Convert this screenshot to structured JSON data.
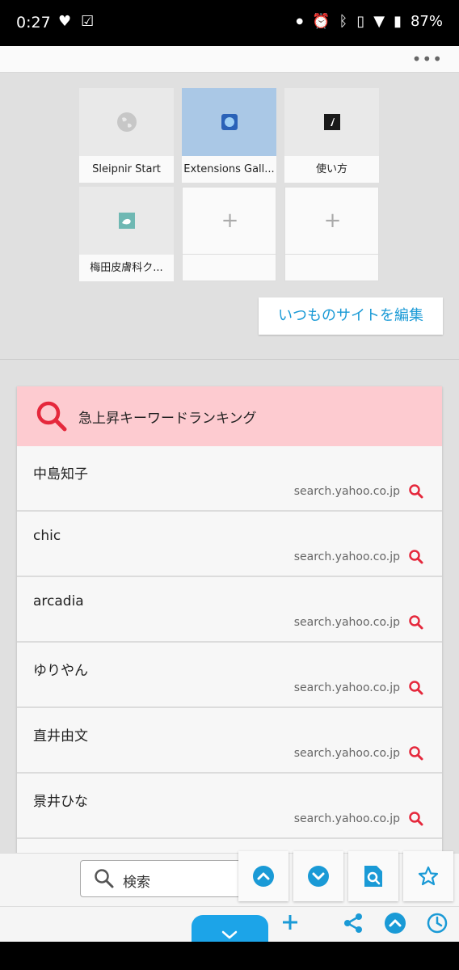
{
  "status_bar": {
    "time": "0:27",
    "battery": "87%",
    "left_icons": [
      "heart-icon",
      "check-box-icon"
    ],
    "right_icons": [
      "dot-icon",
      "alarm-icon",
      "bluetooth-icon",
      "vibrate-icon",
      "wifi-icon",
      "battery-icon"
    ]
  },
  "top_bar": {
    "menu": "•••"
  },
  "speed_dial": {
    "tiles": [
      {
        "label": "Sleipnir Start",
        "icon": "globe-icon"
      },
      {
        "label": "Extensions Gall...",
        "icon": "extensions-icon"
      },
      {
        "label": "使い方",
        "icon": "sleipnir-logo-icon"
      },
      {
        "label": "梅田皮膚科ク...",
        "icon": "clinic-icon"
      },
      {
        "label": "",
        "icon": "plus-icon"
      },
      {
        "label": "",
        "icon": "plus-icon"
      }
    ],
    "edit_button": "いつものサイトを編集"
  },
  "trending": {
    "title": "急上昇キーワードランキング",
    "rows": [
      {
        "keyword": "中島知子",
        "source": "search.yahoo.co.jp"
      },
      {
        "keyword": "chic",
        "source": "search.yahoo.co.jp"
      },
      {
        "keyword": "arcadia",
        "source": "search.yahoo.co.jp"
      },
      {
        "keyword": "ゆりやん",
        "source": "search.yahoo.co.jp"
      },
      {
        "keyword": "直井由文",
        "source": "search.yahoo.co.jp"
      },
      {
        "keyword": "景井ひな",
        "source": "search.yahoo.co.jp"
      },
      {
        "keyword": "",
        "source": ""
      }
    ]
  },
  "bottom": {
    "search_label": "検索",
    "floating_buttons": [
      "chevron-up-icon",
      "chevron-down-icon",
      "page-search-icon",
      "star-icon"
    ],
    "toolbar_icons": [
      "plus-icon",
      "share-icon",
      "chevron-up-icon",
      "history-icon"
    ],
    "tab_icon": "chevron-down-icon"
  },
  "colors": {
    "accent": "#1a9ad6",
    "trend_header": "#fdcbd0",
    "search_red": "#e5283c"
  }
}
